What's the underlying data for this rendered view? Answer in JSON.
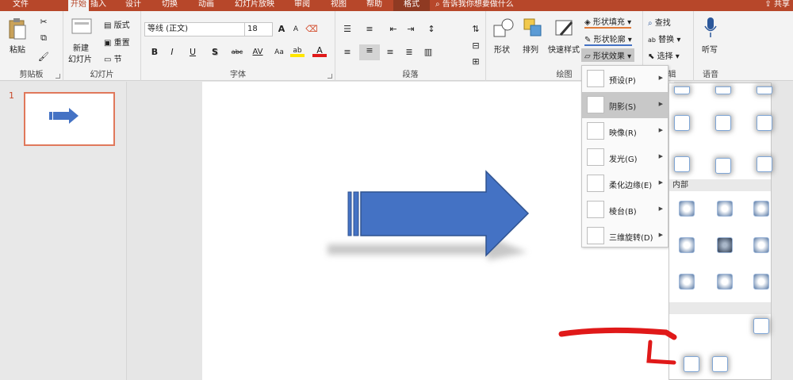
{
  "tabs": [
    {
      "label": "文件",
      "state": "normal"
    },
    {
      "label": "开始",
      "state": "active"
    },
    {
      "label": "插入",
      "state": "normal"
    },
    {
      "label": "设计",
      "state": "normal"
    },
    {
      "label": "切换",
      "state": "normal"
    },
    {
      "label": "动画",
      "state": "normal"
    },
    {
      "label": "幻灯片放映",
      "state": "normal"
    },
    {
      "label": "审阅",
      "state": "normal"
    },
    {
      "label": "视图",
      "state": "normal"
    },
    {
      "label": "帮助",
      "state": "normal"
    },
    {
      "label": "格式",
      "state": "format"
    }
  ],
  "tellme": "告诉我你想要做什么",
  "share": "共享",
  "ribbon": {
    "clipboard": {
      "label": "剪贴板",
      "paste": "粘贴"
    },
    "slides": {
      "label": "幻灯片",
      "new_slide_line1": "新建",
      "new_slide_line2": "幻灯片",
      "layout": "版式",
      "reset": "重置",
      "section": "节"
    },
    "font": {
      "label": "字体",
      "font_name": "等线 (正文)",
      "font_size": "18",
      "grow": "A",
      "shrink": "A",
      "bold": "B",
      "italic": "I",
      "underline": "U",
      "shadow": "S",
      "strike": "abc",
      "spacing": "AV",
      "case": "Aa",
      "highlight": "ab",
      "color": "A"
    },
    "paragraph": {
      "label": "段落"
    },
    "drawing": {
      "label": "绘图",
      "shapes": "形状",
      "arrange": "排列",
      "quick_styles": "快速样式",
      "fill": "形状填充",
      "outline": "形状轮廓",
      "effects": "形状效果"
    },
    "editing": {
      "label": "编辑",
      "find": "查找",
      "replace": "替换",
      "select": "选择"
    },
    "voice": {
      "label": "语音",
      "dictate": "听写"
    }
  },
  "slide_panel": {
    "number": "1"
  },
  "effects_menu": [
    {
      "label": "预设(P)",
      "highlighted": false
    },
    {
      "label": "阴影(S)",
      "highlighted": true
    },
    {
      "label": "映像(R)",
      "highlighted": false
    },
    {
      "label": "发光(G)",
      "highlighted": false
    },
    {
      "label": "柔化边缘(E)",
      "highlighted": false
    },
    {
      "label": "棱台(B)",
      "highlighted": false
    },
    {
      "label": "三维旋转(D)",
      "highlighted": false
    }
  ],
  "shadow_gallery": {
    "inner_header": "内部"
  },
  "colors": {
    "accent": "#b7472a",
    "arrow_fill": "#4472c4",
    "arrow_stroke": "#2f528f",
    "annotation": "#e01919"
  }
}
